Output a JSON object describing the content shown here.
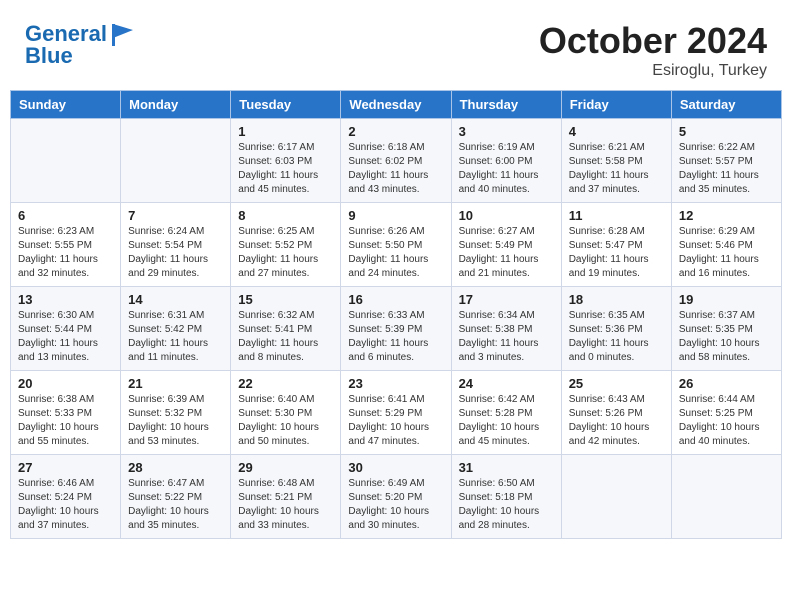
{
  "header": {
    "logo_line1": "General",
    "logo_line2": "Blue",
    "month": "October 2024",
    "location": "Esiroglu, Turkey"
  },
  "days_of_week": [
    "Sunday",
    "Monday",
    "Tuesday",
    "Wednesday",
    "Thursday",
    "Friday",
    "Saturday"
  ],
  "weeks": [
    [
      {
        "day": "",
        "info": ""
      },
      {
        "day": "",
        "info": ""
      },
      {
        "day": "1",
        "info": "Sunrise: 6:17 AM\nSunset: 6:03 PM\nDaylight: 11 hours and 45 minutes."
      },
      {
        "day": "2",
        "info": "Sunrise: 6:18 AM\nSunset: 6:02 PM\nDaylight: 11 hours and 43 minutes."
      },
      {
        "day": "3",
        "info": "Sunrise: 6:19 AM\nSunset: 6:00 PM\nDaylight: 11 hours and 40 minutes."
      },
      {
        "day": "4",
        "info": "Sunrise: 6:21 AM\nSunset: 5:58 PM\nDaylight: 11 hours and 37 minutes."
      },
      {
        "day": "5",
        "info": "Sunrise: 6:22 AM\nSunset: 5:57 PM\nDaylight: 11 hours and 35 minutes."
      }
    ],
    [
      {
        "day": "6",
        "info": "Sunrise: 6:23 AM\nSunset: 5:55 PM\nDaylight: 11 hours and 32 minutes."
      },
      {
        "day": "7",
        "info": "Sunrise: 6:24 AM\nSunset: 5:54 PM\nDaylight: 11 hours and 29 minutes."
      },
      {
        "day": "8",
        "info": "Sunrise: 6:25 AM\nSunset: 5:52 PM\nDaylight: 11 hours and 27 minutes."
      },
      {
        "day": "9",
        "info": "Sunrise: 6:26 AM\nSunset: 5:50 PM\nDaylight: 11 hours and 24 minutes."
      },
      {
        "day": "10",
        "info": "Sunrise: 6:27 AM\nSunset: 5:49 PM\nDaylight: 11 hours and 21 minutes."
      },
      {
        "day": "11",
        "info": "Sunrise: 6:28 AM\nSunset: 5:47 PM\nDaylight: 11 hours and 19 minutes."
      },
      {
        "day": "12",
        "info": "Sunrise: 6:29 AM\nSunset: 5:46 PM\nDaylight: 11 hours and 16 minutes."
      }
    ],
    [
      {
        "day": "13",
        "info": "Sunrise: 6:30 AM\nSunset: 5:44 PM\nDaylight: 11 hours and 13 minutes."
      },
      {
        "day": "14",
        "info": "Sunrise: 6:31 AM\nSunset: 5:42 PM\nDaylight: 11 hours and 11 minutes."
      },
      {
        "day": "15",
        "info": "Sunrise: 6:32 AM\nSunset: 5:41 PM\nDaylight: 11 hours and 8 minutes."
      },
      {
        "day": "16",
        "info": "Sunrise: 6:33 AM\nSunset: 5:39 PM\nDaylight: 11 hours and 6 minutes."
      },
      {
        "day": "17",
        "info": "Sunrise: 6:34 AM\nSunset: 5:38 PM\nDaylight: 11 hours and 3 minutes."
      },
      {
        "day": "18",
        "info": "Sunrise: 6:35 AM\nSunset: 5:36 PM\nDaylight: 11 hours and 0 minutes."
      },
      {
        "day": "19",
        "info": "Sunrise: 6:37 AM\nSunset: 5:35 PM\nDaylight: 10 hours and 58 minutes."
      }
    ],
    [
      {
        "day": "20",
        "info": "Sunrise: 6:38 AM\nSunset: 5:33 PM\nDaylight: 10 hours and 55 minutes."
      },
      {
        "day": "21",
        "info": "Sunrise: 6:39 AM\nSunset: 5:32 PM\nDaylight: 10 hours and 53 minutes."
      },
      {
        "day": "22",
        "info": "Sunrise: 6:40 AM\nSunset: 5:30 PM\nDaylight: 10 hours and 50 minutes."
      },
      {
        "day": "23",
        "info": "Sunrise: 6:41 AM\nSunset: 5:29 PM\nDaylight: 10 hours and 47 minutes."
      },
      {
        "day": "24",
        "info": "Sunrise: 6:42 AM\nSunset: 5:28 PM\nDaylight: 10 hours and 45 minutes."
      },
      {
        "day": "25",
        "info": "Sunrise: 6:43 AM\nSunset: 5:26 PM\nDaylight: 10 hours and 42 minutes."
      },
      {
        "day": "26",
        "info": "Sunrise: 6:44 AM\nSunset: 5:25 PM\nDaylight: 10 hours and 40 minutes."
      }
    ],
    [
      {
        "day": "27",
        "info": "Sunrise: 6:46 AM\nSunset: 5:24 PM\nDaylight: 10 hours and 37 minutes."
      },
      {
        "day": "28",
        "info": "Sunrise: 6:47 AM\nSunset: 5:22 PM\nDaylight: 10 hours and 35 minutes."
      },
      {
        "day": "29",
        "info": "Sunrise: 6:48 AM\nSunset: 5:21 PM\nDaylight: 10 hours and 33 minutes."
      },
      {
        "day": "30",
        "info": "Sunrise: 6:49 AM\nSunset: 5:20 PM\nDaylight: 10 hours and 30 minutes."
      },
      {
        "day": "31",
        "info": "Sunrise: 6:50 AM\nSunset: 5:18 PM\nDaylight: 10 hours and 28 minutes."
      },
      {
        "day": "",
        "info": ""
      },
      {
        "day": "",
        "info": ""
      }
    ]
  ]
}
